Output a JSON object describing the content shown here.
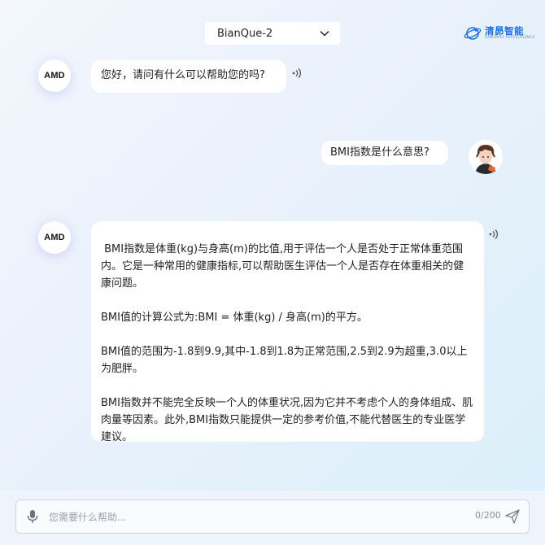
{
  "header": {
    "model_select": {
      "value": "BianQue-2",
      "icon": "chevron-down-icon"
    },
    "brand": {
      "name": "清昴智能",
      "sub": "QINGMAO INTELLIGENCE",
      "icon": "planet-logo-icon"
    }
  },
  "messages": [
    {
      "role": "assistant",
      "avatar": "AMD",
      "text": "您好，请问有什么可以帮助您的吗?"
    },
    {
      "role": "user",
      "text": "BMI指数是什么意思?"
    },
    {
      "role": "assistant",
      "avatar": "AMD",
      "paragraphs": [
        " BMI指数是体重(kg)与身高(m)的比值,用于评估一个人是否处于正常体重范围内。它是一种常用的健康指标,可以帮助医生评估一个人是否存在体重相关的健康问题。",
        "BMI值的计算公式为:BMI = 体重(kg) / 身高(m)的平方。",
        "BMI值的范围为-1.8到9.9,其中-1.8到1.8为正常范围,2.5到2.9为超重,3.0以上为肥胖。",
        "BMI指数并不能完全反映一个人的体重状况,因为它并不考虑个人的身体组成、肌肉量等因素。此外,BMI指数只能提供一定的参考价值,不能代替医生的专业医学建议。"
      ]
    }
  ],
  "input": {
    "placeholder": "您需要什么帮助...",
    "value": "",
    "counter": "0/200"
  },
  "colors": {
    "brand": "#1e6fe0",
    "background_start": "#f3f6fd",
    "background_end": "#d9f0fa"
  }
}
